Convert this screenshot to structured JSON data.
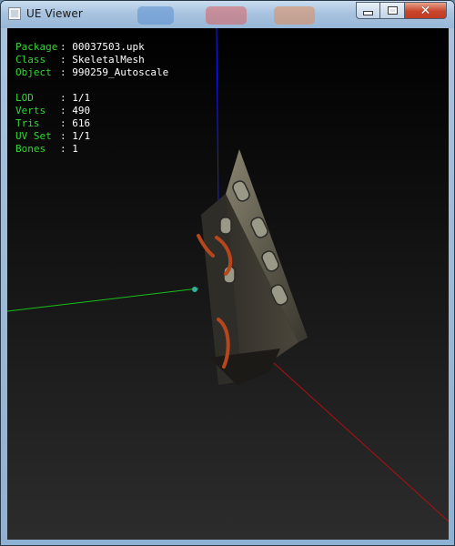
{
  "window": {
    "title": "UE Viewer",
    "buttons": {
      "minimize": "minimize",
      "maximize": "maximize",
      "close": "close"
    }
  },
  "info": {
    "group1": [
      {
        "key": "Package",
        "value": "00037503.upk"
      },
      {
        "key": "Class",
        "value": "SkeletalMesh"
      },
      {
        "key": "Object",
        "value": "990259_Autoscale"
      }
    ],
    "group2": [
      {
        "key": "LOD",
        "value": "1/1"
      },
      {
        "key": "Verts",
        "value": "490"
      },
      {
        "key": "Tris",
        "value": "616"
      },
      {
        "key": "UV Set",
        "value": "1/1"
      },
      {
        "key": "Bones",
        "value": "1"
      }
    ],
    "separator": ":"
  },
  "colors": {
    "label_green": "#35d535",
    "value_white": "#ffffff",
    "axis_x": "#b01010",
    "axis_y": "#18c018",
    "axis_z": "#1a1aff"
  }
}
